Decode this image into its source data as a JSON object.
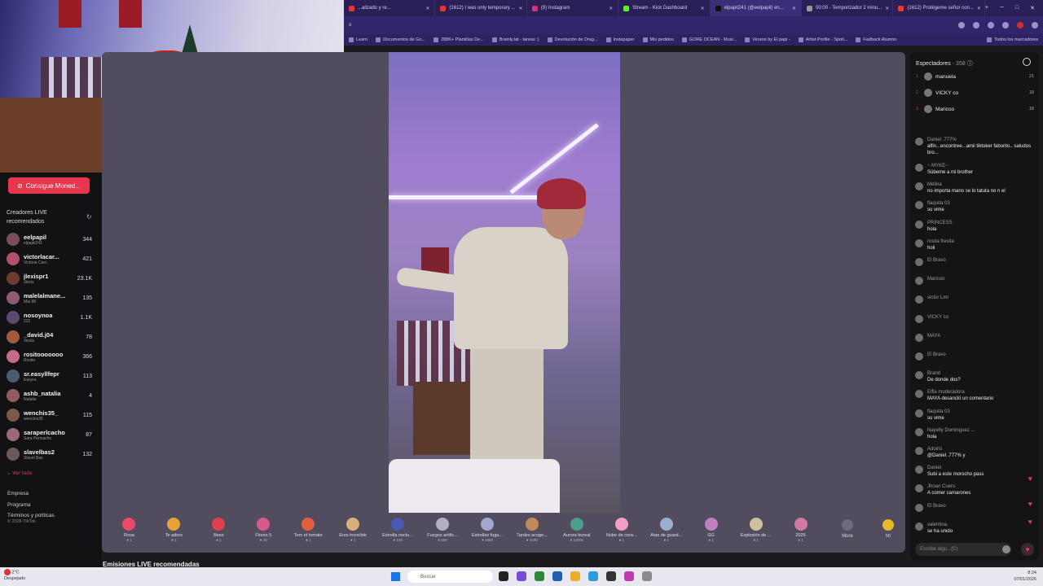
{
  "browser": {
    "tabs": [
      {
        "label": "...alizado y re..."
      },
      {
        "label": "(1612) I was only temporary ..."
      },
      {
        "label": "(9) Instagram"
      },
      {
        "label": "Stream - Kick Dashboard"
      },
      {
        "label": "elpapil241 (@eelpapil) en..."
      },
      {
        "label": "00:00 - Temporizador 2 minu..."
      },
      {
        "label": "(1612) Protégeme señor con..."
      }
    ],
    "bookmarks": [
      "Learn",
      "Documentos de Go...",
      "288K+ Plantillas De...",
      "Brainly.lat - tareas :)",
      "Devolución de Drag...",
      "Instapaper",
      "Mis pedidos",
      "GORE OCEAN - Musi...",
      "Verano by El papi -",
      "Artist Profile - Spoti...",
      "Fadback Alumno"
    ],
    "all_bookmarks": "Todos los marcadores"
  },
  "sidebar": {
    "coin_button": "Consigue Moned...",
    "creators_title": "Creadores LIVE recomendados",
    "creators": [
      {
        "name": "eelpapil",
        "sub": "elpapil241",
        "count": "344",
        "color": "#7a4c5f"
      },
      {
        "name": "victorlacar...",
        "sub": "Victoria Caro",
        "count": "421",
        "color": "#b3516b"
      },
      {
        "name": "jlexispr1",
        "sub": "Jlexis",
        "count": "23.1K",
        "color": "#6b3d2f"
      },
      {
        "name": "malelalmane...",
        "sub": "Mai 88",
        "count": "135",
        "color": "#8d5c7a"
      },
      {
        "name": "nosoynoa",
        "sub": "222",
        "count": "1.1K",
        "color": "#5b4a6e"
      },
      {
        "name": "_david.j04",
        "sub": "Jesús",
        "count": "78",
        "color": "#a35a3a"
      },
      {
        "name": "rositooooooo",
        "sub": "Rosito",
        "count": "366",
        "color": "#c76a8a"
      },
      {
        "name": "sr.easyllfepr",
        "sub": "Easyra",
        "count": "113",
        "color": "#4f5b6c"
      },
      {
        "name": "ashb_natalia",
        "sub": "Natalia",
        "count": "4",
        "color": "#915c62"
      },
      {
        "name": "wenchis35_",
        "sub": "wenchis35",
        "count": "115",
        "color": "#7c5a4a"
      },
      {
        "name": "saraperlcacho",
        "sub": "Sara Pericacho",
        "count": "87",
        "color": "#9a6a7c"
      },
      {
        "name": "slavelbas2",
        "sub": "Slavel Bas",
        "count": "132",
        "color": "#6a5a5a"
      }
    ],
    "see_all": "Ver todo",
    "links": [
      "Empresa",
      "Programa",
      "Términos y políticas"
    ],
    "copyright": "© 2026 TikTok"
  },
  "gifts": [
    {
      "name": "Rosa",
      "price": "1",
      "color": "#e84b6a"
    },
    {
      "name": "Te adoro",
      "price": "1",
      "color": "#e8a23a"
    },
    {
      "name": "Beso",
      "price": "1",
      "color": "#e04050"
    },
    {
      "name": "Flores 5",
      "price": "30",
      "color": "#d85a8a"
    },
    {
      "name": "Tom et tomate",
      "price": "1",
      "color": "#e06040"
    },
    {
      "name": "Eres increíble",
      "price": "1",
      "color": "#d9b07a"
    },
    {
      "name": "Estrella noctu...",
      "price": "199",
      "color": "#4a5ab0"
    },
    {
      "name": "Fuegos artific...",
      "price": "500",
      "color": "#b0b0c0"
    },
    {
      "name": "Estrellas fuga...",
      "price": "1500",
      "color": "#a0a8d0"
    },
    {
      "name": "Tardes acoge...",
      "price": "4000",
      "color": "#c08a5a"
    },
    {
      "name": "Aurora boreal",
      "price": "12000",
      "color": "#4aa08a"
    },
    {
      "name": "Nube de cora...",
      "price": "1",
      "color": "#f0a0c0"
    },
    {
      "name": "Atas de guard...",
      "price": "1",
      "color": "#9ab0d0"
    },
    {
      "name": "GG",
      "price": "1",
      "color": "#c080c0"
    },
    {
      "name": "Explosión de ...",
      "price": "1",
      "color": "#d0c0a0"
    },
    {
      "name": "2026",
      "price": "1",
      "color": "#d07aa0"
    }
  ],
  "gift_more": "More",
  "coins": "50",
  "recommended_heading": "Emisiones LIVE recomendadas",
  "chat": {
    "viewers_label": "Espectadores",
    "viewers_count": "358",
    "top_viewers": [
      {
        "rank": "1",
        "name": "manuela",
        "score": "21"
      },
      {
        "rank": "2",
        "name": "VICKY co",
        "score": "18"
      },
      {
        "rank": "3",
        "name": "Maricoo",
        "score": "18"
      }
    ],
    "messages": [
      {
        "user": "Daniel .777%",
        "text": "alfin...encontree...amii tiktoker faborito.. saludos bro..."
      },
      {
        "user": "~ MYKE~",
        "text": "Súbeme a mi brother"
      },
      {
        "user": "Melina",
        "text": "no importa mano se lo tatuta no n el"
      },
      {
        "user": "flaquita 03",
        "text": "su vime"
      },
      {
        "user": "PRINCESS",
        "text": "hola"
      },
      {
        "user": "rosita fresita",
        "text": "holi"
      },
      {
        "user": "El Bravo",
        "text": ""
      },
      {
        "user": "Maricoo",
        "text": ""
      },
      {
        "user": "victor Lmr",
        "text": ""
      },
      {
        "user": "VICKY co",
        "text": ""
      },
      {
        "user": "MAYA",
        "text": ""
      },
      {
        "user": "El Bravo",
        "text": ""
      },
      {
        "user": "Brand",
        "text": "De donde dos?"
      },
      {
        "user": "Elfla moderadora",
        "text": "MAYA desancló un comentario"
      },
      {
        "user": "flaquita 03",
        "text": "su vime"
      },
      {
        "user": "Nayelly Dominguez ...",
        "text": "hola"
      },
      {
        "user": "Adoiris",
        "text": "@Daniel .777% y"
      },
      {
        "user": "Daniel",
        "text": "Subi a este morocho pass"
      },
      {
        "user": "Jhoan Cuero",
        "text": "A comer camarones"
      },
      {
        "user": "El Bravo",
        "text": ""
      },
      {
        "user": "valentina.",
        "text": "se ha unido"
      }
    ],
    "input_placeholder": "Escribe algo...(C)"
  },
  "taskbar": {
    "temp": "2°C",
    "weather": "Despejado",
    "search_placeholder": "Buscar",
    "time": "8:24",
    "date": "07/01/2026"
  }
}
